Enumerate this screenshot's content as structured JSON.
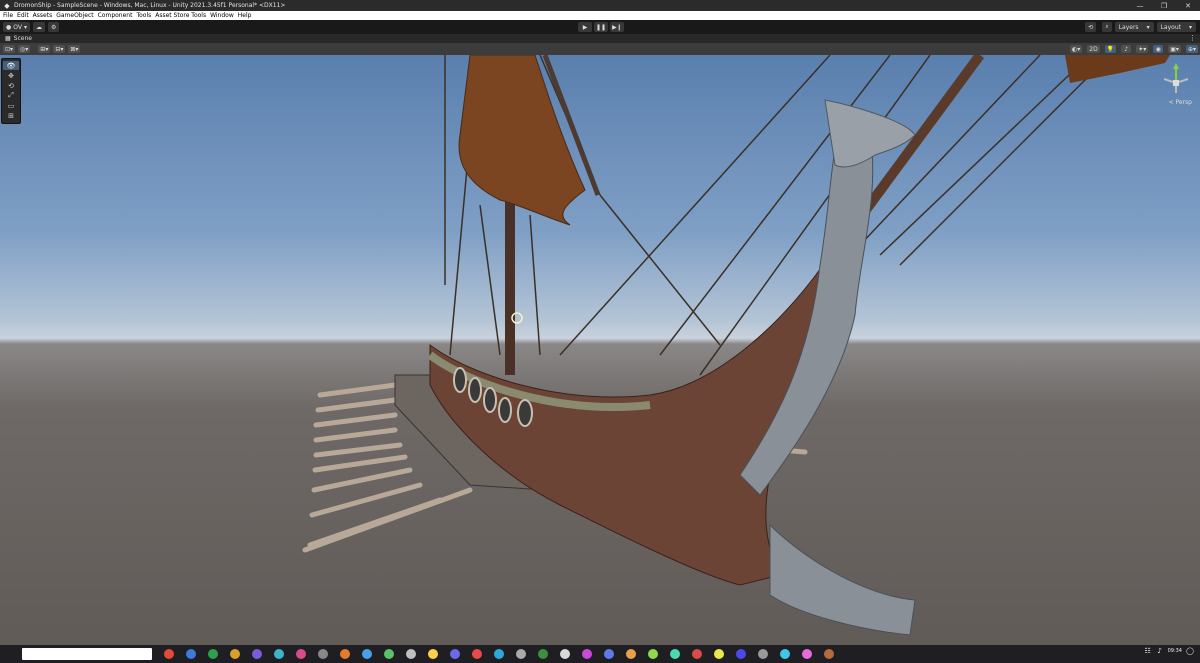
{
  "window": {
    "title": "DromonShip - SampleScene - Windows, Mac, Linux - Unity 2021.3.45f1 Personal* <DX11>",
    "controls": [
      "—",
      "❐",
      "✕"
    ]
  },
  "menu": [
    "File",
    "Edit",
    "Assets",
    "GameObject",
    "Component",
    "Tools",
    "Asset Store Tools",
    "Window",
    "Help"
  ],
  "toolbar": {
    "account_label": "OV",
    "layers_label": "Layers",
    "layout_label": "Layout",
    "play": [
      "▶",
      "❚❚",
      "▶❙"
    ]
  },
  "scene_tab": {
    "label": "Scene"
  },
  "scene_toolbar": {
    "twod_label": "2D"
  },
  "tools": [
    "👁",
    "✥",
    "⟲",
    "⤢",
    "▭",
    "⊞"
  ],
  "gizmo": {
    "label": "< Persp"
  },
  "taskbar": {
    "clock": "09:34",
    "icon_colors": [
      "#e24b3a",
      "#3b7bd9",
      "#2f9f4f",
      "#d8a028",
      "#7b5bd9",
      "#3bb3c9",
      "#d94b8a",
      "#888888",
      "#e57a2f",
      "#4a9fe8",
      "#5cc06a",
      "#c0c0c0",
      "#ffd04a",
      "#6a6ae8",
      "#e84a4a",
      "#2fa8d9",
      "#aaaaaa",
      "#3c8f3c",
      "#d9d9d9",
      "#c94ad9",
      "#5c7be8",
      "#e8a04a",
      "#8fd94a",
      "#4ad9b3",
      "#d94a4a",
      "#e8e84a",
      "#4a4ae8",
      "#999999",
      "#3fc6e8",
      "#e86ad9",
      "#b36a3f"
    ]
  }
}
